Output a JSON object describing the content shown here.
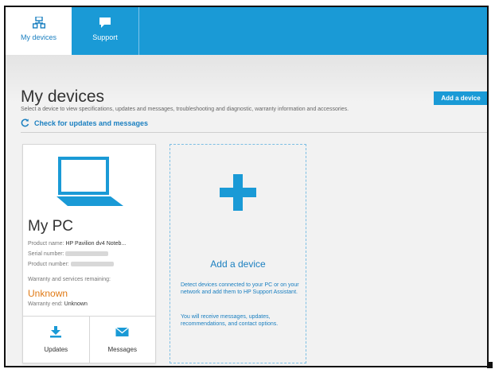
{
  "nav": {
    "tabs": [
      {
        "label": "My devices",
        "icon": "devices-icon"
      },
      {
        "label": "Support",
        "icon": "chat-icon"
      }
    ]
  },
  "header": {
    "title": "My devices",
    "subtitle": "Select a device to view specifications, updates and messages, troubleshooting and diagnostic, warranty information and accessories.",
    "check_updates": "Check for updates and messages",
    "add_device_button": "Add a device"
  },
  "device": {
    "name": "My PC",
    "product_name_label": "Product name:",
    "product_name_value": "HP Pavilion dv4 Noteb...",
    "serial_label": "Serial number:",
    "product_number_label": "Product number:",
    "warranty_label": "Warranty and services remaining:",
    "warranty_status": "Unknown",
    "warranty_end_label": "Warranty end:",
    "warranty_end_value": "Unknown",
    "actions": [
      {
        "label": "Updates",
        "icon": "download-icon"
      },
      {
        "label": "Messages",
        "icon": "envelope-icon"
      }
    ]
  },
  "add_device": {
    "title": "Add a device",
    "desc1": "Detect devices connected to your PC or on your network and add them to HP Support Assistant.",
    "desc2": "You will receive messages, updates, recommendations, and contact options."
  },
  "colors": {
    "accent": "#1a9ad6",
    "link": "#1a7fc0",
    "warning": "#e07a16"
  }
}
